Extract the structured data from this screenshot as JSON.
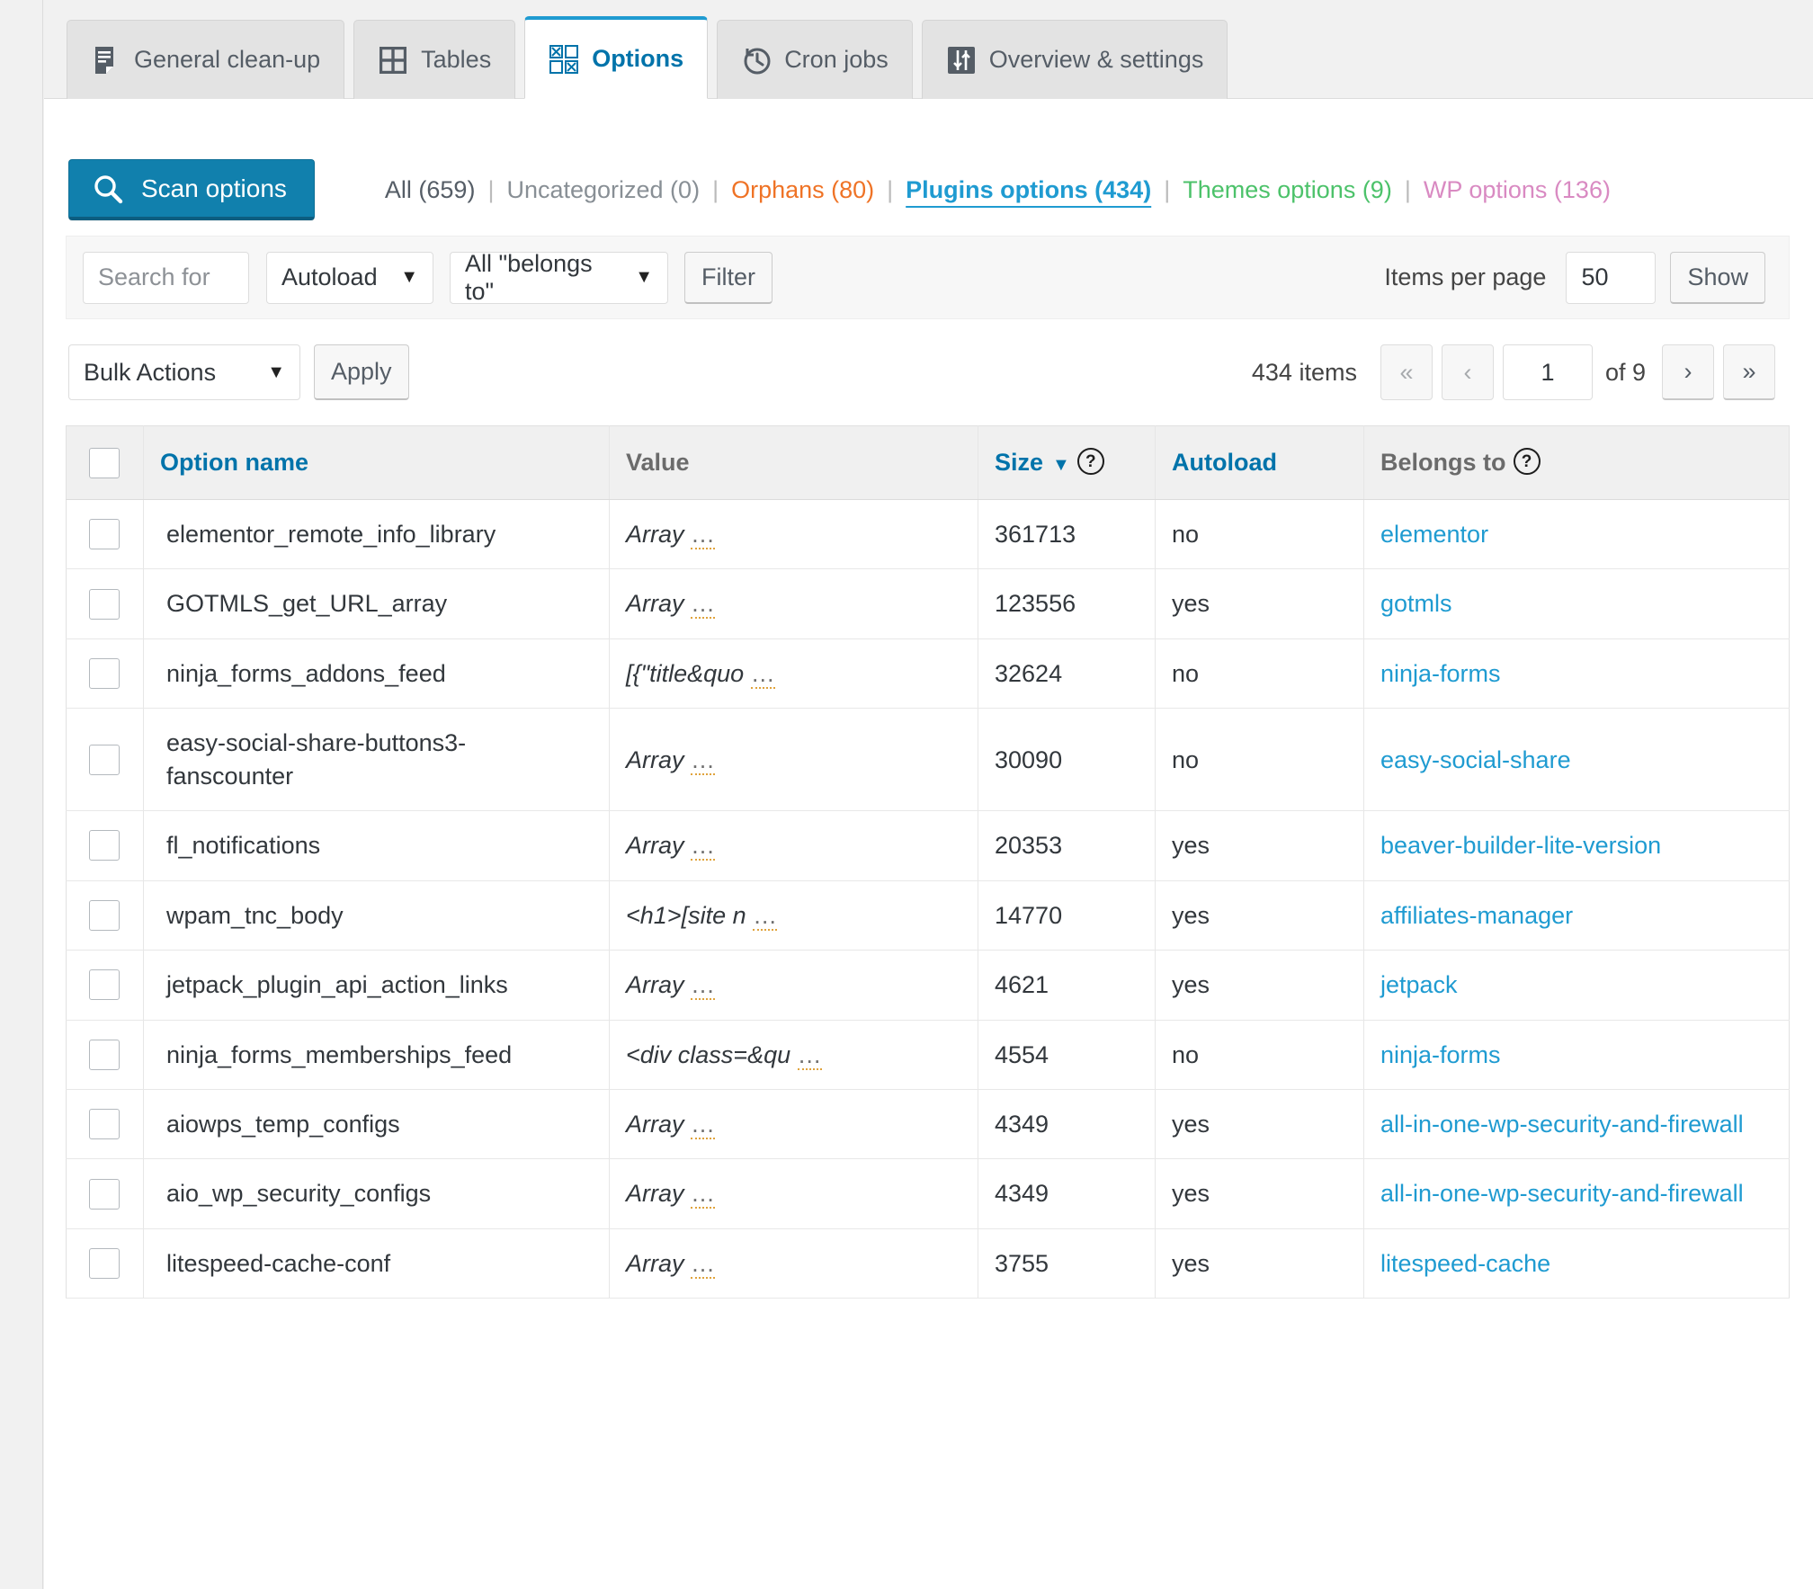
{
  "tabs": [
    {
      "label": "General clean-up",
      "icon": "document-clean-icon",
      "active": false
    },
    {
      "label": "Tables",
      "icon": "grid-table-icon",
      "active": false
    },
    {
      "label": "Options",
      "icon": "checkbox-grid-icon",
      "active": true
    },
    {
      "label": "Cron jobs",
      "icon": "clock-history-icon",
      "active": false
    },
    {
      "label": "Overview & settings",
      "icon": "sliders-icon",
      "active": false
    }
  ],
  "scan_button": {
    "label": "Scan options",
    "icon": "search-icon",
    "color": "#1180ad"
  },
  "view_links": [
    {
      "label": "All (659)",
      "class": "l-all",
      "active": false
    },
    {
      "label": "Uncategorized (0)",
      "class": "l-uncat",
      "active": false
    },
    {
      "label": "Orphans (80)",
      "class": "l-orph",
      "active": false
    },
    {
      "label": "Plugins options (434)",
      "class": "l-plug",
      "active": true
    },
    {
      "label": "Themes options (9)",
      "class": "l-theme",
      "active": false
    },
    {
      "label": "WP options (136)",
      "class": "l-wp",
      "active": false
    }
  ],
  "filter_bar": {
    "search_placeholder": "Search for",
    "search_value": "",
    "autoload_select": "Autoload",
    "belongs_select": "All \"belongs to\"",
    "filter_button": "Filter",
    "items_per_page_label": "Items per page",
    "items_per_page_value": "50",
    "show_button": "Show"
  },
  "bulk_bar": {
    "bulk_select": "Bulk Actions",
    "apply_button": "Apply",
    "items_count": "434 items",
    "first_page": "«",
    "prev_page": "‹",
    "page_number": "1",
    "of_total": "of 9",
    "next_page": "›",
    "last_page": "»"
  },
  "table": {
    "columns": [
      {
        "label": "Option name",
        "style": "th-link",
        "sort": "",
        "help": false
      },
      {
        "label": "Value",
        "style": "th-plain",
        "sort": "",
        "help": false
      },
      {
        "label": "Size",
        "style": "th-link",
        "sort": "▼",
        "help": true
      },
      {
        "label": "Autoload",
        "style": "th-link",
        "sort": "",
        "help": false
      },
      {
        "label": "Belongs to",
        "style": "th-plain",
        "sort": "",
        "help": true
      }
    ],
    "rows": [
      {
        "name": "elementor_remote_info_library",
        "value": "Array",
        "value_more": "…",
        "size": "361713",
        "autoload": "no",
        "belongs_to": "elementor"
      },
      {
        "name": "GOTMLS_get_URL_array",
        "value": "Array",
        "value_more": "…",
        "size": "123556",
        "autoload": "yes",
        "belongs_to": "gotmls"
      },
      {
        "name": "ninja_forms_addons_feed",
        "value": "[{\"title&quo",
        "value_more": "…",
        "size": "32624",
        "autoload": "no",
        "belongs_to": "ninja-forms"
      },
      {
        "name": "easy-social-share-buttons3-fanscounter",
        "value": "Array",
        "value_more": "…",
        "size": "30090",
        "autoload": "no",
        "belongs_to": "easy-social-share"
      },
      {
        "name": "fl_notifications",
        "value": "Array",
        "value_more": "…",
        "size": "20353",
        "autoload": "yes",
        "belongs_to": "beaver-builder-lite-version"
      },
      {
        "name": "wpam_tnc_body",
        "value": "<h1>[site n",
        "value_more": "…",
        "size": "14770",
        "autoload": "yes",
        "belongs_to": "affiliates-manager"
      },
      {
        "name": "jetpack_plugin_api_action_links",
        "value": "Array",
        "value_more": "…",
        "size": "4621",
        "autoload": "yes",
        "belongs_to": "jetpack"
      },
      {
        "name": "ninja_forms_memberships_feed",
        "value": "<div class=&qu",
        "value_more": "…",
        "size": "4554",
        "autoload": "no",
        "belongs_to": "ninja-forms"
      },
      {
        "name": "aiowps_temp_configs",
        "value": "Array",
        "value_more": "…",
        "size": "4349",
        "autoload": "yes",
        "belongs_to": "all-in-one-wp-security-and-firewall"
      },
      {
        "name": "aio_wp_security_configs",
        "value": "Array",
        "value_more": "…",
        "size": "4349",
        "autoload": "yes",
        "belongs_to": "all-in-one-wp-security-and-firewall"
      },
      {
        "name": "litespeed-cache-conf",
        "value": "Array",
        "value_more": "…",
        "size": "3755",
        "autoload": "yes",
        "belongs_to": "litespeed-cache"
      }
    ]
  }
}
